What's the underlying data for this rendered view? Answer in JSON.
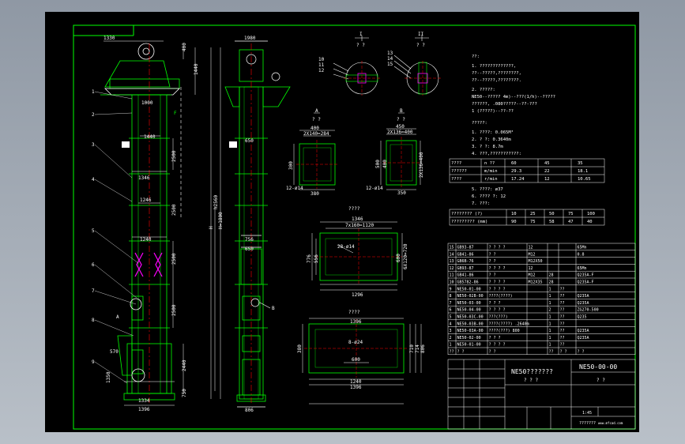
{
  "drawing": {
    "colors": {
      "frame": "#00ff00",
      "dim": "#ffffff",
      "body": "#00ff00",
      "center": "#ff0000",
      "accent": "#ff00ff",
      "yellow": "#ffff00",
      "cyan": "#00ffff"
    },
    "front_view": {
      "dim_top_width": "1330",
      "dim_top_h1": "400",
      "dim_top_h2": "1440",
      "dim_head": "1000",
      "label_f": "F",
      "dim_1440": "1440",
      "dim_1346": "1346",
      "dim_1246": "1246",
      "dim_1240": "1240",
      "dim_2500_a": "2500",
      "dim_2500_b": "2500",
      "dim_2500_c": "2500",
      "dim_2500_d": "2500",
      "dim_total": "H=1800",
      "dim_h": "H",
      "dim_h2560": "h2560",
      "dim_bottom_750": "750",
      "dim_bottom_2440": "2440",
      "dim_570": "570",
      "dim_1350": "1350",
      "dim_1334": "1334",
      "dim_1396": "1396",
      "callouts": [
        "1",
        "2",
        "3",
        "4",
        "5",
        "6",
        "7",
        "8",
        "9"
      ],
      "letter_a": "A"
    },
    "side_view": {
      "dim_top": "1980",
      "dim_mid": "650",
      "dim_lower": "756",
      "dim_lower2": "650",
      "dim_bottom": "806",
      "label_b": "B"
    },
    "section_1": {
      "title": "I",
      "sub": "? ?",
      "tags": [
        "10",
        "11",
        "12"
      ]
    },
    "section_2": {
      "title": "II",
      "sub": "? ?",
      "tags": [
        "13",
        "14",
        "15"
      ]
    },
    "view_a": {
      "title": "A",
      "sub": "? ?",
      "w": "400",
      "holes": "2X140=284",
      "h": "300",
      "side": "380",
      "foot": "12-ø14"
    },
    "view_b": {
      "title": "B",
      "sub": "? ?",
      "w": "450",
      "holes": "2X136=400",
      "h": "500",
      "side": "350",
      "foot": "12-ø14",
      "h2": "400",
      "r": "2X136=400"
    },
    "top_flange": {
      "title": "????",
      "w1": "1346",
      "holes": "7x160=1120",
      "label": "28-ø14",
      "h1": "776",
      "h2": "556",
      "side": "600",
      "r": "6X120=720",
      "w2": "1296"
    },
    "bottom_flange": {
      "title": "????",
      "w1": "1396",
      "label": "8-ø24",
      "h1": "380",
      "inner": "600",
      "w2": "1240",
      "w3": "1396",
      "r1": "710",
      "r2": "714",
      "r3": "806"
    },
    "notes": {
      "title": "??:",
      "lines": [
        "1. ?????????????,",
        "   ??--?????,????????,",
        "   ??--?????,????????.",
        "2. ?????:",
        "   NE50--????? 4m)--???(1/h)--?????",
        "   ??????, .080?????--??-???",
        "                1 (?????)--??-??",
        "          ?????:",
        "1. ????: 0.065M³",
        "2. ?    ?: 0.3640m",
        "3. ?    ?: 8.7m",
        "4. ???,???????????:"
      ]
    },
    "speed_table": {
      "rows": [
        [
          "????",
          "n ??",
          "60",
          "45",
          "35"
        ],
        [
          "??????",
          "m/min",
          "29.3",
          "22",
          "18.1"
        ],
        [
          "????",
          "r/min",
          "17.24",
          "12",
          "10.65"
        ]
      ]
    },
    "notes2": {
      "lines": [
        "5. ????: ø37",
        "6. ???? ?: 12",
        "7. ???:"
      ]
    },
    "size_table": {
      "rows": [
        [
          "???????? (?)",
          "10",
          "25",
          "50",
          "75",
          "100"
        ],
        [
          "????????? (mm)",
          "90",
          "75",
          "58",
          "47",
          "40"
        ]
      ]
    },
    "parts_list": {
      "rows": [
        [
          "15",
          "GB93-87",
          "? ? ? ?",
          "12",
          "",
          "",
          "65Mn"
        ],
        [
          "14",
          "GB41-86",
          "? ?",
          "M12",
          "",
          "",
          "0.8"
        ],
        [
          "13",
          "GB6B-76",
          "? ?",
          "M12X50",
          "",
          "",
          ""
        ],
        [
          "12",
          "GB93-87",
          "? ? ? ?",
          "12",
          "",
          "",
          "65Mn"
        ],
        [
          "11",
          "GB41-86",
          "? ?",
          "M12",
          "28",
          "",
          "Q235A-F"
        ],
        [
          "10",
          "GB5782-86",
          "? ? ? ?",
          "M12X35",
          "28",
          "",
          "Q235A-F"
        ],
        [
          "9",
          "NE50-01-00",
          "? ? ? ?",
          "",
          "1",
          "??",
          ""
        ],
        [
          "8",
          "NE50-02B-00",
          "????(????)",
          "",
          "1",
          "??",
          "Q235A"
        ],
        [
          "7",
          "NE50-03-00",
          "? ? ?",
          "",
          "1",
          "??",
          "Q235A"
        ],
        [
          "6",
          "NE50-04-00",
          "? ? ? ?",
          "",
          "2",
          "??",
          "ZG270-500"
        ],
        [
          "5",
          "NE50-03C-00",
          "???(???)",
          "",
          "1",
          "??",
          "Q235"
        ],
        [
          "4",
          "NE50-03B-00",
          "????(????) .2640m",
          "",
          "1",
          "??",
          ""
        ],
        [
          "3",
          "NE50-03A-00",
          "????(???) 800",
          "",
          "1",
          "??",
          "Q235A"
        ],
        [
          "2",
          "NE50-02-00",
          "? ? ?",
          "",
          "1",
          "??",
          "Q235A"
        ],
        [
          "1",
          "NE50-01-00",
          "? ? ? ?",
          "",
          "1",
          "??",
          ""
        ],
        [
          "??",
          "? ?",
          "? ?",
          "",
          "??",
          "? ?",
          "? ?"
        ]
      ]
    },
    "title_block": {
      "name": "NE50???????",
      "name_sub": "? ? ?",
      "code": "NE50-00-00",
      "code_sub": "? ?",
      "scale": "1:45",
      "company": "???????",
      "website": "www.mfcad.com"
    }
  }
}
